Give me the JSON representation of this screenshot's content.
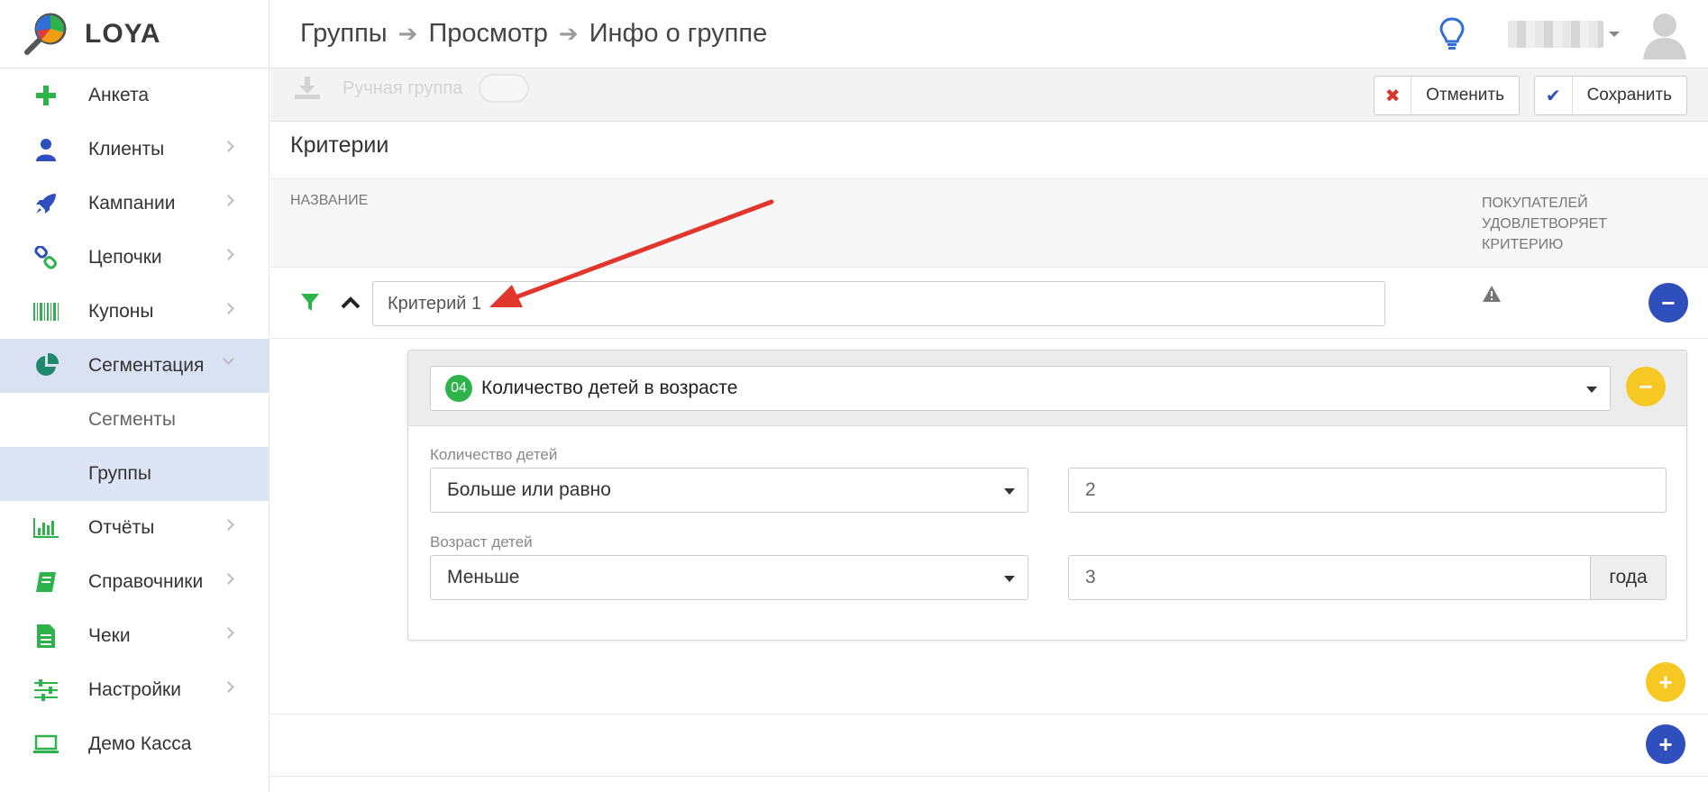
{
  "app": {
    "logo_text": "LOYA"
  },
  "breadcrumb": [
    {
      "label": "Группы"
    },
    {
      "label": "Просмотр"
    },
    {
      "label": "Инфо о группе"
    }
  ],
  "sidebar": {
    "items": [
      {
        "label": "Анкета",
        "icon": "plus-icon"
      },
      {
        "label": "Клиенты",
        "icon": "user-icon"
      },
      {
        "label": "Кампании",
        "icon": "rocket-icon"
      },
      {
        "label": "Цепочки",
        "icon": "chain-icon"
      },
      {
        "label": "Купоны",
        "icon": "barcode-icon"
      },
      {
        "label": "Сегментация",
        "icon": "pie-chart-icon"
      },
      {
        "label": "Сегменты"
      },
      {
        "label": "Группы"
      },
      {
        "label": "Отчёты",
        "icon": "bar-chart-icon"
      },
      {
        "label": "Справочники",
        "icon": "book-icon"
      },
      {
        "label": "Чеки",
        "icon": "receipt-icon"
      },
      {
        "label": "Настройки",
        "icon": "sliders-icon"
      },
      {
        "label": "Демо Касса",
        "icon": "laptop-icon"
      }
    ]
  },
  "toolbar": {
    "manual_group_label": "Ручная группа",
    "cancel_label": "Отменить",
    "save_label": "Сохранить"
  },
  "criteria": {
    "title": "Критерии",
    "col_name": "НАЗВАНИЕ",
    "col_buyers": [
      "ПОКУПАТЕЛЕЙ",
      "УДОВЛЕТВОРЯЕТ",
      "КРИТЕРИЮ"
    ],
    "criterion_value": "Критерий 1",
    "condition": {
      "badge": "04",
      "selected": "Количество детей в возрасте",
      "count_label": "Количество детей",
      "count_operator": "Больше или равно",
      "count_value": "2",
      "age_label": "Возраст детей",
      "age_operator": "Меньше",
      "age_value": "3",
      "age_unit": "года"
    }
  },
  "colors": {
    "accent_green": "#2db34a",
    "accent_blue": "#2f4fbd",
    "accent_yellow": "#f7c823",
    "active_nav": "#d9e1f2",
    "annotation_arrow": "#e0362c"
  }
}
